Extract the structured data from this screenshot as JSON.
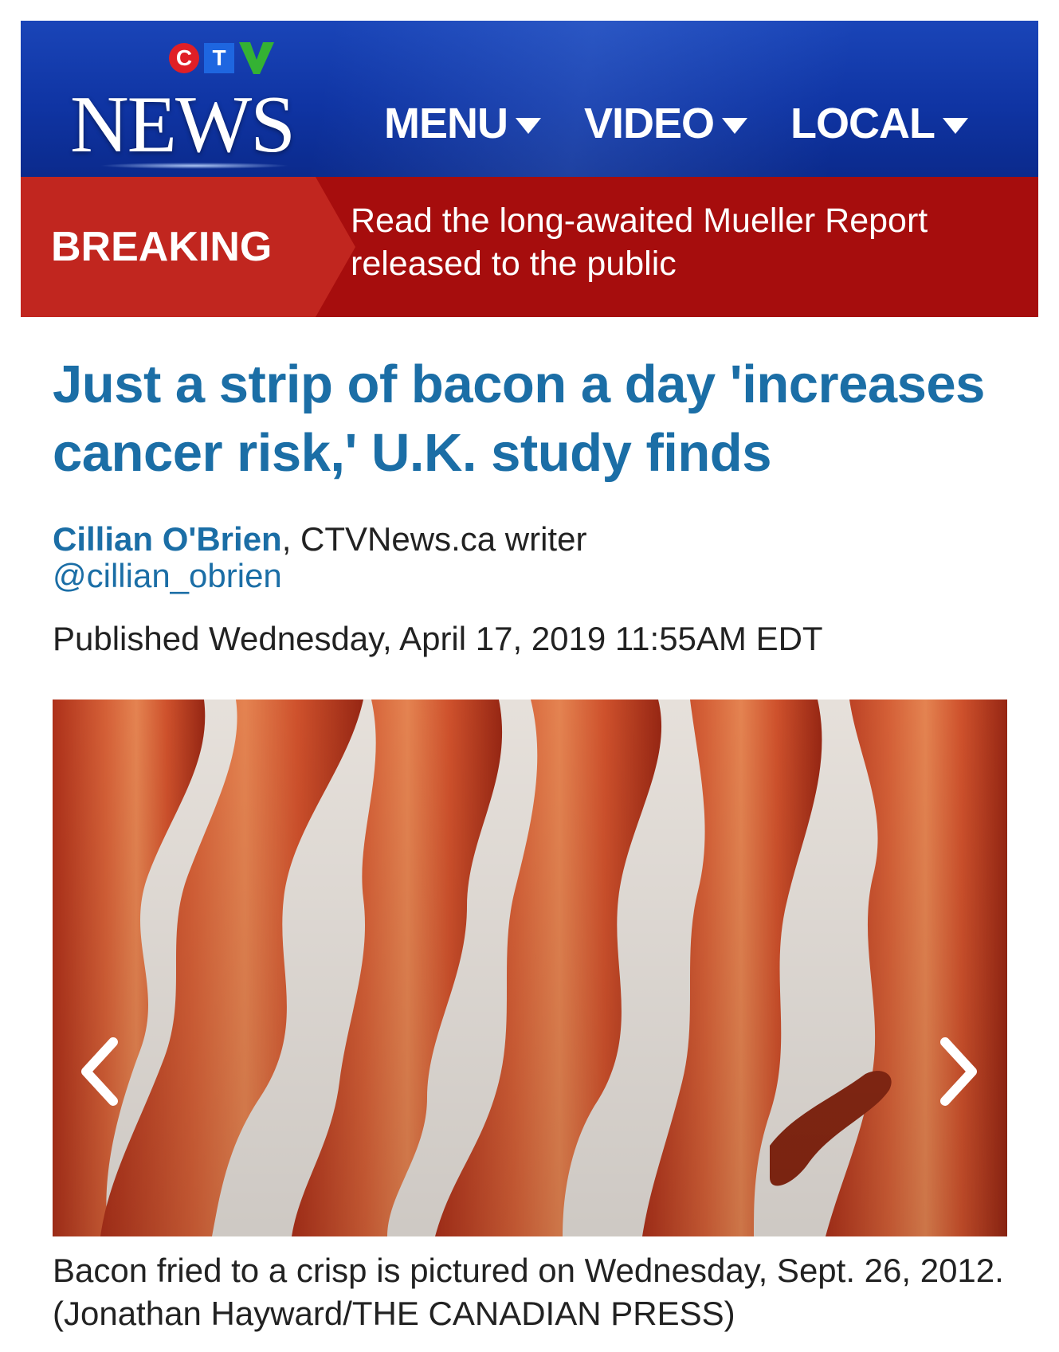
{
  "header": {
    "logo": {
      "letters": [
        "C",
        "T",
        "V"
      ],
      "wordmark": "NEWS",
      "colors": {
        "c": "#e01f26",
        "t": "#1e66e0",
        "v": "#34b233"
      }
    },
    "nav": [
      {
        "label": "MENU"
      },
      {
        "label": "VIDEO"
      },
      {
        "label": "LOCAL"
      }
    ],
    "colors": {
      "bar": "#0f34a3"
    }
  },
  "breaking": {
    "label": "BREAKING",
    "text": "Read the long-awaited Mueller Report released to the public",
    "colors": {
      "label_bg": "#c1261f",
      "bar": "#a60d0d"
    }
  },
  "article": {
    "headline": "Just a strip of bacon a day 'increases cancer risk,' U.K. study finds",
    "author": "Cillian O'Brien",
    "author_suffix": ", CTVNews.ca writer",
    "handle": "@cillian_obrien",
    "published": "Published Wednesday, April 17, 2019 11:55AM EDT",
    "image": {
      "subject": "strips of fried bacon on a white plate",
      "controls": {
        "prev_icon": "chevron-left-icon",
        "next_icon": "chevron-right-icon"
      }
    },
    "caption": "Bacon fried to a crisp is pictured on Wednesday, Sept. 26, 2012. (Jonathan Hayward/THE CANADIAN PRESS)",
    "colors": {
      "link": "#1b6ea6",
      "body_text": "#222222"
    }
  }
}
